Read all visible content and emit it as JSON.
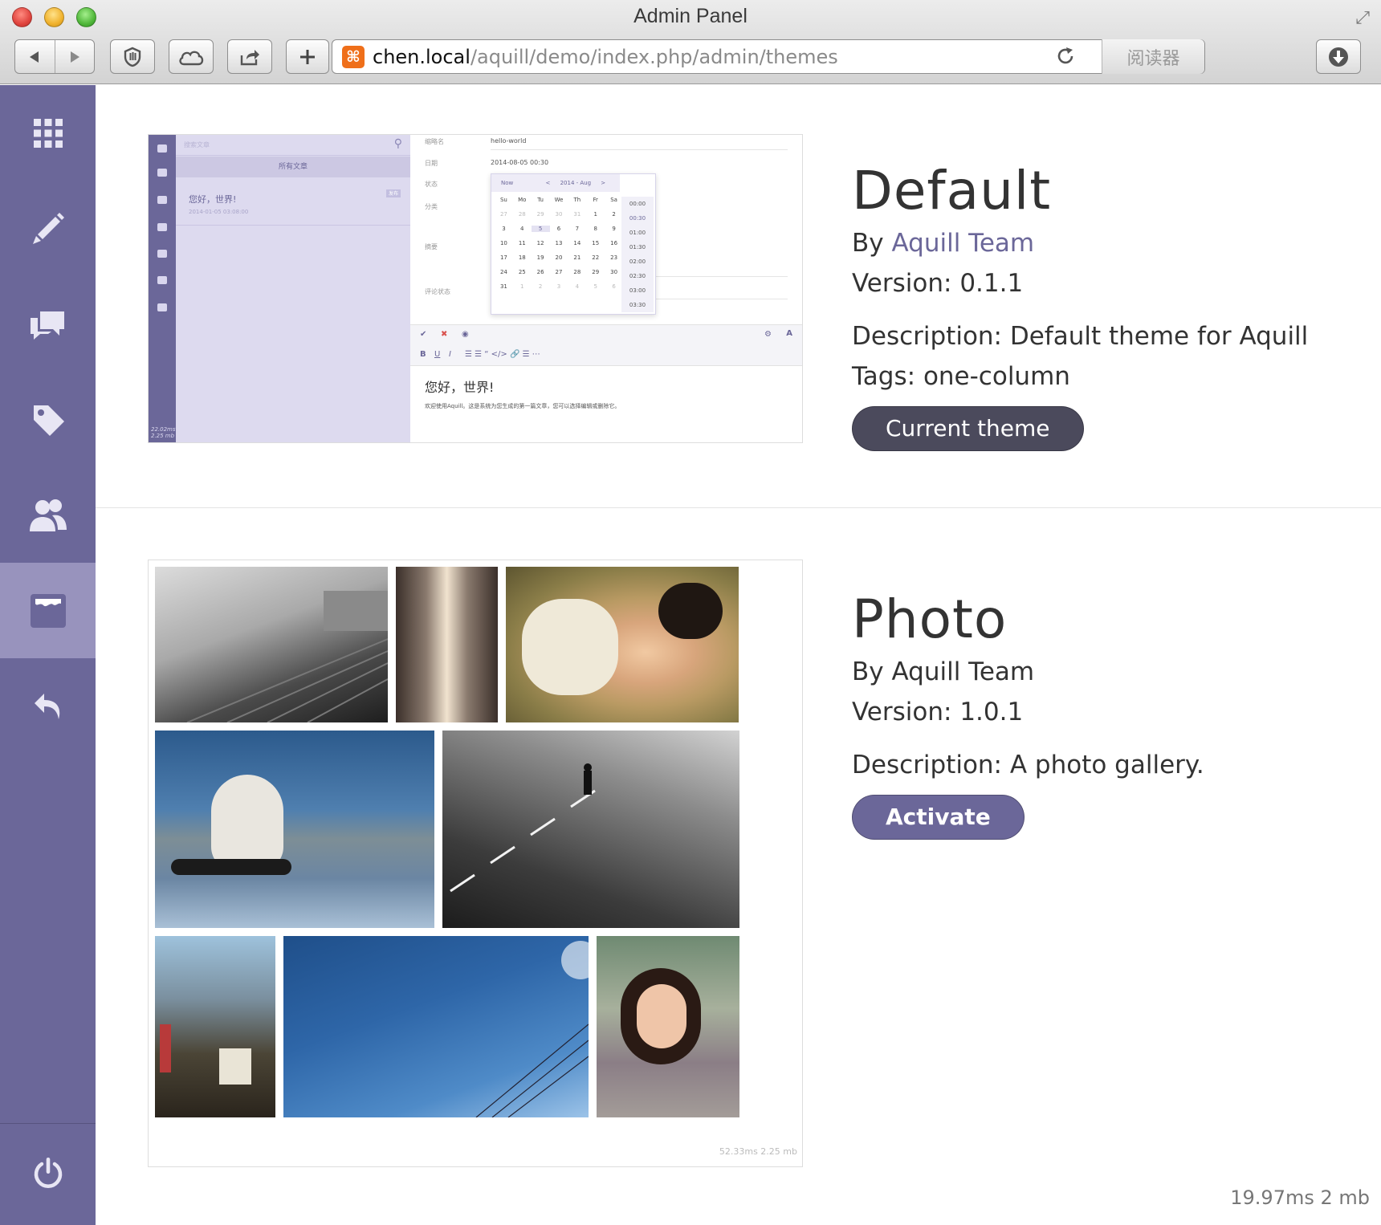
{
  "window": {
    "title": "Admin Panel"
  },
  "url": {
    "host": "chen.local",
    "path": "/aquill/demo/index.php/admin/themes",
    "reader_label": "阅读器"
  },
  "sidebar": {
    "items": [
      {
        "icon": "apps-grid-icon",
        "active": false
      },
      {
        "icon": "pencil-icon",
        "active": false
      },
      {
        "icon": "comments-icon",
        "active": false
      },
      {
        "icon": "tag-icon",
        "active": false
      },
      {
        "icon": "users-icon",
        "active": false
      },
      {
        "icon": "themes-icon",
        "active": true
      },
      {
        "icon": "back-arrow-icon",
        "active": false
      }
    ],
    "bottom_icon": "power-icon",
    "accent": "#6b6799",
    "active_bg": "#9893bd"
  },
  "themes": [
    {
      "name": "Default",
      "by_label": "By",
      "author": "Aquill Team",
      "version_label": "Version:",
      "version": "0.1.1",
      "description_label": "Description:",
      "description": "Default theme for Aquill",
      "tags_label": "Tags:",
      "tags": "one-column",
      "button": "Current theme"
    },
    {
      "name": "Photo",
      "by_label": "By",
      "author": "Aquill Team",
      "version_label": "Version:",
      "version": "1.0.1",
      "description_label": "Description:",
      "description": "A photo gallery.",
      "button": "Activate"
    }
  ],
  "preview_default": {
    "search_placeholder": "搜索文章",
    "filter_label": "所有文章",
    "post_title": "您好，世界!",
    "post_date": "2014-01-05 03:08:00",
    "post_badge": "发布",
    "side_stats": "22.02ms 2.25 mb",
    "field_slug_label": "缩略名",
    "field_slug_value": "hello-world",
    "field_date_label": "日期",
    "field_date_value": "2014-08-05 00:30",
    "field_status_label": "状态",
    "field_category_label": "分类",
    "field_excerpt_label": "摘要",
    "field_comment_label": "评论状态",
    "cal_now": "Now",
    "cal_prev": "<",
    "cal_month": "2014 - Aug",
    "cal_next": ">",
    "cal_weekdays": [
      "Su",
      "Mo",
      "Tu",
      "We",
      "Th",
      "Fr",
      "Sa"
    ],
    "cal_days": [
      "27",
      "28",
      "29",
      "30",
      "31",
      "1",
      "2",
      "3",
      "4",
      "5",
      "6",
      "7",
      "8",
      "9",
      "10",
      "11",
      "12",
      "13",
      "14",
      "15",
      "16",
      "17",
      "18",
      "19",
      "20",
      "21",
      "22",
      "23",
      "24",
      "25",
      "26",
      "27",
      "28",
      "29",
      "30",
      "31",
      "1",
      "2",
      "3",
      "4",
      "5",
      "6"
    ],
    "cal_times": [
      "00:00",
      "00:30",
      "01:00",
      "01:30",
      "02:00",
      "02:30",
      "03:00",
      "03:30"
    ],
    "editor_title": "您好，世界!",
    "editor_text": "欢迎使用Aquill。这是系统为您生成的第一篇文章，您可以选择编辑或删除它。"
  },
  "preview_photo": {
    "stats": "52.33ms 2.25 mb"
  },
  "footer": {
    "stats": "19.97ms  2 mb"
  }
}
